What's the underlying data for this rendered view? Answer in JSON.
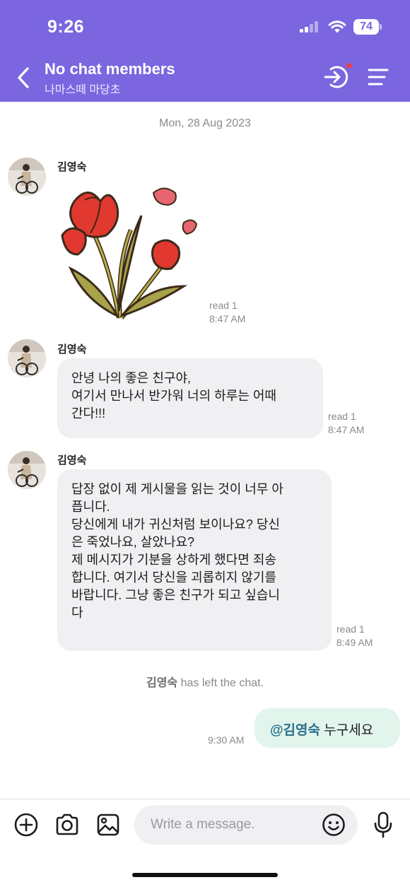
{
  "status_bar": {
    "time": "9:26",
    "battery": "74"
  },
  "header": {
    "title": "No chat members",
    "subtitle": "나마스떼 마당초",
    "back_icon": "chevron-left-icon",
    "enter_icon": "enter-chat-icon",
    "menu_icon": "menu-icon"
  },
  "chat": {
    "date": "Mon, 28 Aug 2023",
    "messages": [
      {
        "sender": "김영숙",
        "type": "sticker",
        "sticker": "tulip-sticker",
        "read": "read 1",
        "time": "8:47 AM"
      },
      {
        "sender": "김영숙",
        "type": "text",
        "lines": [
          "안녕 나의 좋은 친구야,",
          "여기서 만나서 반가워 너의 하루는 어때",
          "간다!!!"
        ],
        "read": "read 1",
        "time": "8:47 AM"
      },
      {
        "sender": "김영숙",
        "type": "text",
        "lines": [
          "답장 없이 제 게시물을 읽는 것이 너무 아",
          "픕니다.",
          "당신에게 내가 귀신처럼 보이나요? 당신",
          "은 죽었나요, 살았나요?",
          "제 메시지가 기분을 상하게 했다면 죄송",
          "합니다. 여기서 당신을 괴롭히지 않기를",
          "바랍니다. 그냥 좋은 친구가 되고 싶습니",
          "다"
        ],
        "read": "read 1",
        "time": "8:49 AM"
      }
    ],
    "system_message": {
      "name": "김영숙",
      "text": " has left the chat."
    },
    "outgoing": {
      "mention": "@김영숙",
      "text": " 누구세요",
      "time": "9:30 AM"
    }
  },
  "input_bar": {
    "placeholder": "Write a message.",
    "icons": [
      "plus-icon",
      "camera-icon",
      "gallery-icon",
      "emoji-icon",
      "mic-icon"
    ]
  },
  "colors": {
    "header": "#7b66e0",
    "incoming_bubble": "#f0f0f2",
    "outgoing_bubble": "#e2f5ec",
    "mention": "#2a6f8a"
  }
}
